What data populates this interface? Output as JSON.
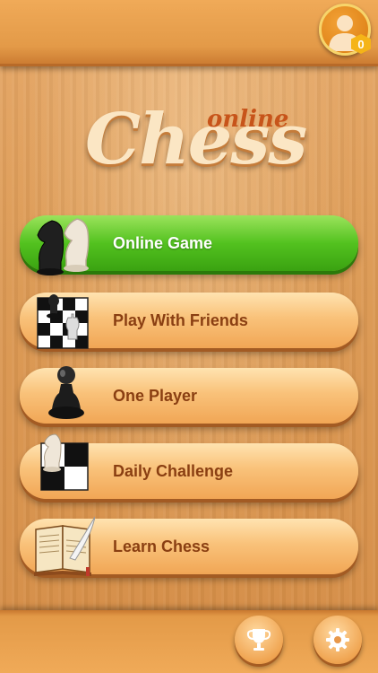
{
  "profile": {
    "badge_count": "0",
    "icon": "user-silhouette-icon"
  },
  "logo": {
    "title": "Chess",
    "subtitle": "online"
  },
  "menu": [
    {
      "label": "Online Game",
      "icon": "knights-icon",
      "style": "green"
    },
    {
      "label": "Play With Friends",
      "icon": "board-pieces-icon",
      "style": "wood"
    },
    {
      "label": "One Player",
      "icon": "pawn-icon",
      "style": "wood"
    },
    {
      "label": "Daily Challenge",
      "icon": "knight-board-icon",
      "style": "wood"
    },
    {
      "label": "Learn Chess",
      "icon": "book-quill-icon",
      "style": "wood"
    }
  ],
  "footer": {
    "left_icon": "trophy-icon",
    "right_icon": "gear-icon"
  },
  "colors": {
    "primary_green": "#53c21f",
    "wood": "#f1a655",
    "label_brown": "#8a3f12"
  }
}
